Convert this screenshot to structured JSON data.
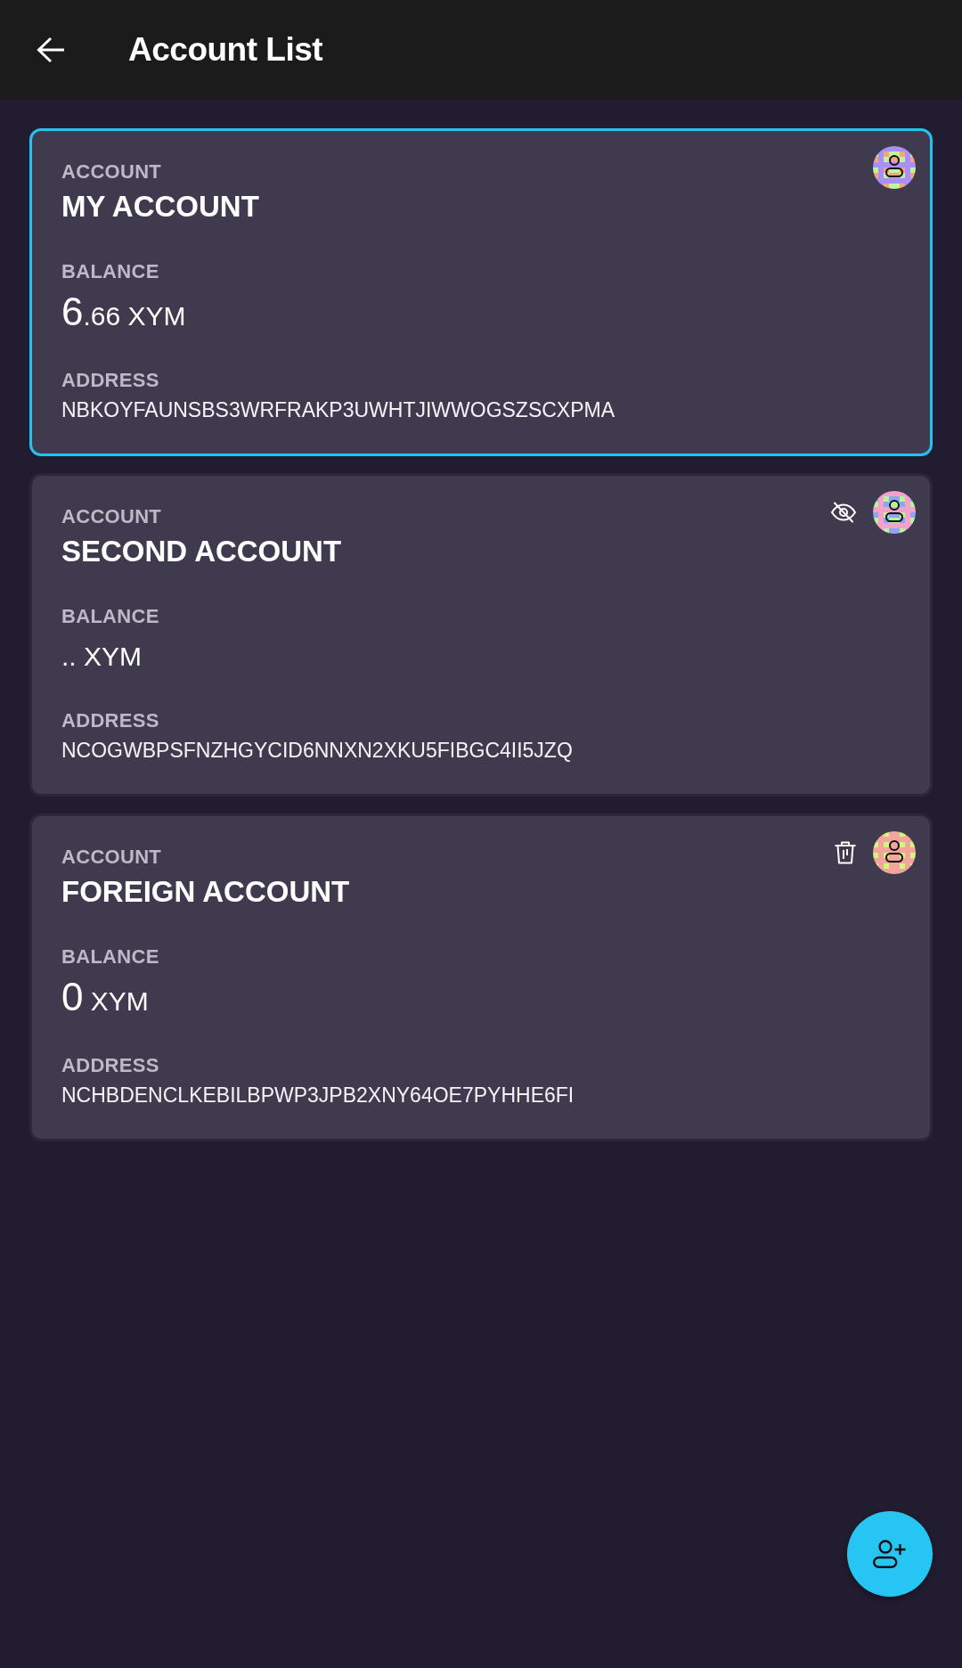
{
  "app_bar": {
    "title": "Account List"
  },
  "accounts": [
    {
      "selected": true,
      "kind": "plain",
      "label": "ACCOUNT",
      "name": "MY ACCOUNT",
      "balance_label": "BALANCE",
      "balance": {
        "integer": "6",
        "fraction": ".66",
        "ticker": "XYM"
      },
      "address_label": "ADDRESS",
      "address": "NBKOYFAUNSBS3WRFRAKP3UWHTJIWWOGSZSCXPMA"
    },
    {
      "selected": false,
      "kind": "hideable",
      "label": "ACCOUNT",
      "name": "SECOND ACCOUNT",
      "balance_label": "BALANCE",
      "balance": {
        "fraction": "..",
        "ticker": "XYM"
      },
      "address_label": "ADDRESS",
      "address": "NCOGWBPSFNZHGYCID6NNXN2XKU5FIBGC4II5JZQ"
    },
    {
      "selected": false,
      "kind": "removable",
      "label": "ACCOUNT",
      "name": "FOREIGN ACCOUNT",
      "balance_label": "BALANCE",
      "balance": {
        "integer": "0",
        "ticker": "XYM"
      },
      "address_label": "ADDRESS",
      "address": "NCHBDENCLKEBILBPWP3JPB2XNY64OE7PYHHE6FI"
    }
  ]
}
